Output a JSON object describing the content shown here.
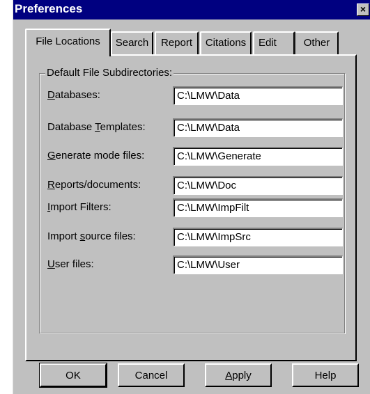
{
  "window": {
    "title": "Preferences",
    "close_glyph": "×"
  },
  "tabs": [
    {
      "label": "File Locations",
      "active": true
    },
    {
      "label": "Search",
      "active": false
    },
    {
      "label": "Report",
      "active": false
    },
    {
      "label": "Citations",
      "active": false
    },
    {
      "label": "Edit",
      "active": false
    },
    {
      "label": "Other",
      "active": false
    }
  ],
  "group": {
    "label": "Default File Subdirectories:",
    "rows": [
      {
        "label_pre": "",
        "label_ul": "D",
        "label_post": "atabases:",
        "value": "C:\\LMW\\Data"
      },
      {
        "label_pre": "Database ",
        "label_ul": "T",
        "label_post": "emplates:",
        "value": "C:\\LMW\\Data"
      },
      {
        "label_pre": "",
        "label_ul": "G",
        "label_post": "enerate mode files:",
        "value": "C:\\LMW\\Generate"
      },
      {
        "label_pre": "",
        "label_ul": "R",
        "label_post": "eports/documents:",
        "value": "C:\\LMW\\Doc"
      },
      {
        "label_pre": "",
        "label_ul": "I",
        "label_post": "mport Filters:",
        "value": "C:\\LMW\\ImpFilt"
      },
      {
        "label_pre": "Import ",
        "label_ul": "s",
        "label_post": "ource files:",
        "value": "C:\\LMW\\ImpSrc"
      },
      {
        "label_pre": "",
        "label_ul": "U",
        "label_post": "ser files:",
        "value": "C:\\LMW\\User"
      }
    ]
  },
  "buttons": {
    "ok": "OK",
    "cancel": "Cancel",
    "apply_ul": "A",
    "apply_rest": "pply",
    "help": "Help"
  }
}
